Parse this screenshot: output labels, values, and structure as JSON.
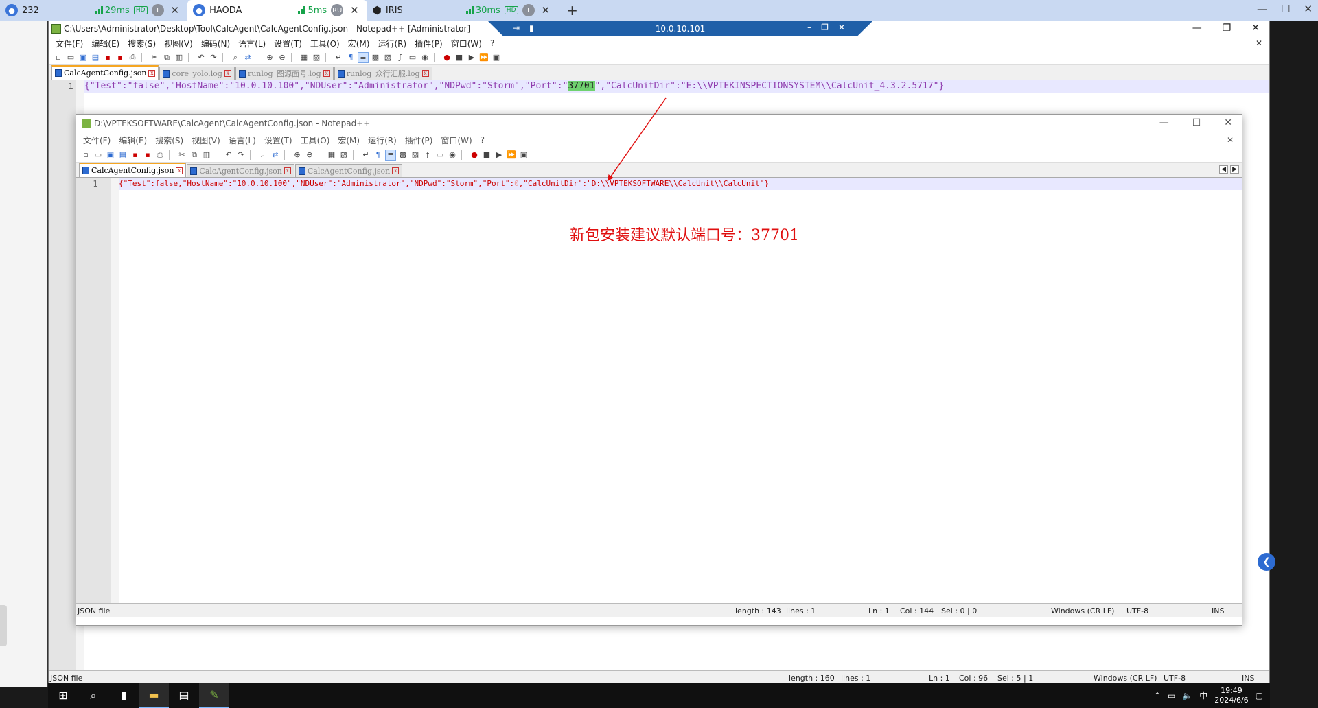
{
  "client_tabs": [
    {
      "label": "232",
      "latency": "29ms",
      "hd": "HD",
      "badge": "T"
    },
    {
      "label": "HAODA",
      "latency": "5ms",
      "hd": "",
      "badge": "RU"
    },
    {
      "label": "IRIS",
      "latency": "30ms",
      "hd": "HD",
      "badge": "T"
    }
  ],
  "rdp_bar": {
    "address": "10.0.10.101"
  },
  "outer": {
    "title": "C:\\Users\\Administrator\\Desktop\\Tool\\CalcAgent\\CalcAgentConfig.json - Notepad++ [Administrator]",
    "menu": [
      "文件(F)",
      "编辑(E)",
      "搜索(S)",
      "视图(V)",
      "编码(N)",
      "语言(L)",
      "设置(T)",
      "工具(O)",
      "宏(M)",
      "运行(R)",
      "插件(P)",
      "窗口(W)",
      "?"
    ],
    "tabs": [
      "CalcAgentConfig.json",
      "core_yolo.log",
      "runlog_图源面号.log",
      "runlog_众行汇服.log"
    ],
    "line_number": "1",
    "code_before": "{\"Test\":\"false\",\"HostName\":\"10.0.10.100\",\"NDUser\":\"Administrator\",\"NDPwd\":\"Storm\",\"Port\":\"",
    "code_highlight": "37701",
    "code_after": "\",\"CalcUnitDir\":\"E:\\\\VPTEKINSPECTIONSYSTEM\\\\CalcUnit_4.3.2.5717\"}",
    "status": {
      "type": "JSON file",
      "length": "length : 160",
      "lines": "lines : 1",
      "ln": "Ln : 1",
      "col": "Col : 96",
      "sel": "Sel : 5 | 1",
      "eol": "Windows (CR LF)",
      "enc": "UTF-8",
      "mode": "INS"
    }
  },
  "inner": {
    "title": "D:\\VPTEKSOFTWARE\\CalcAgent\\CalcAgentConfig.json - Notepad++",
    "menu": [
      "文件(F)",
      "编辑(E)",
      "搜索(S)",
      "视图(V)",
      "语言(L)",
      "设置(T)",
      "工具(O)",
      "宏(M)",
      "运行(R)",
      "插件(P)",
      "窗口(W)",
      "?"
    ],
    "tabs": [
      "CalcAgentConfig.json",
      "CalcAgentConfig.json",
      "CalcAgentConfig.json"
    ],
    "line_number": "1",
    "code_before": "{\"Test\":false,\"HostName\":\"10.0.10.100\",\"NDUser\":\"Administrator\",\"NDPwd\":\"Storm\",\"Port\":",
    "code_port": "0",
    "code_after": ",\"CalcUnitDir\":\"D:\\\\VPTEKSOFTWARE\\\\CalcUnit\\\\CalcUnit\"}",
    "status": {
      "type": "JSON file",
      "length": "length : 143",
      "lines": "lines : 1",
      "ln": "Ln : 1",
      "col": "Col : 144",
      "sel": "Sel : 0 | 0",
      "eol": "Windows (CR LF)",
      "enc": "UTF-8",
      "mode": "INS"
    }
  },
  "annotation": "新包安装建议默认端口号：37701",
  "taskbar": {
    "time": "19:49",
    "date": "2024/6/6",
    "ime": "中"
  }
}
